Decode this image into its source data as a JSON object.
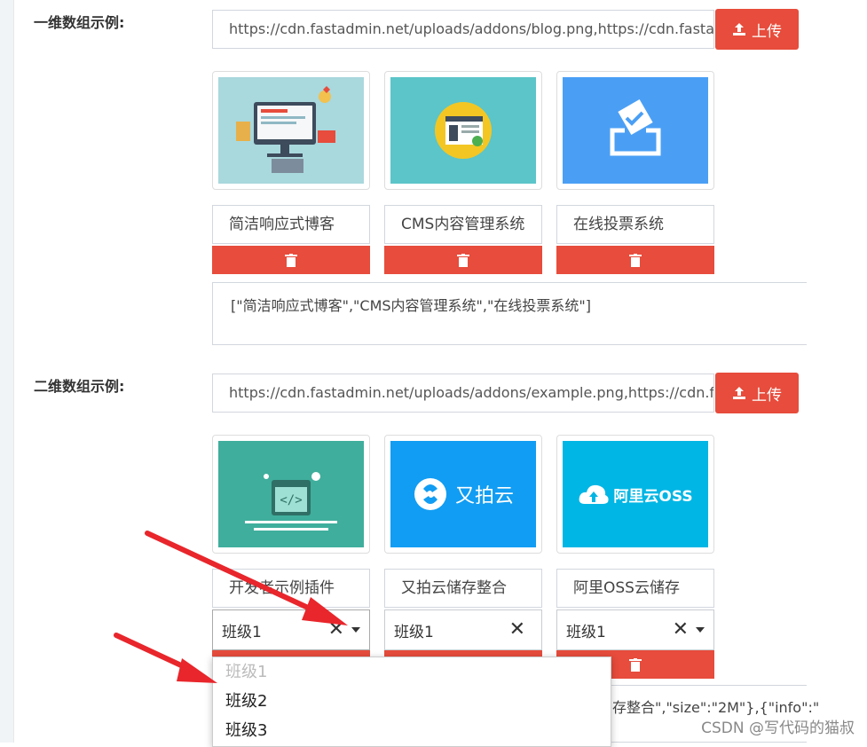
{
  "section1": {
    "label": "一维数组示例:",
    "url_value": "https://cdn.fastadmin.net/uploads/addons/blog.png,https://cdn.fastac",
    "upload_label": "上传",
    "items": [
      {
        "name": "简洁响应式博客",
        "thumb": "blog-illustration"
      },
      {
        "name": "CMS内容管理系统",
        "thumb": "cms-illustration"
      },
      {
        "name": "在线投票系统",
        "thumb": "vote-illustration"
      }
    ],
    "json_text": "[\"简洁响应式博客\",\"CMS内容管理系统\",\"在线投票系统\"]"
  },
  "section2": {
    "label": "二维数组示例:",
    "url_value": "https://cdn.fastadmin.net/uploads/addons/example.png,https://cdn.fa",
    "upload_label": "上传",
    "items": [
      {
        "name": "开发者示例插件",
        "class": "班级1",
        "thumb": "dev-illustration"
      },
      {
        "name": "又拍云储存整合",
        "class": "班级1",
        "thumb": "upyun-logo",
        "logo_text": "又拍云"
      },
      {
        "name": "阿里OSS云储存",
        "class": "班级1",
        "thumb": "oss-logo",
        "logo_text": "阿里云OSS"
      }
    ],
    "json_partial": "存整合\",\"size\":\"2M\"},{\"info\":\"",
    "dropdown_options": [
      {
        "label": "班级1",
        "disabled": true
      },
      {
        "label": "班级2",
        "disabled": false
      },
      {
        "label": "班级3",
        "disabled": false
      }
    ]
  },
  "watermark": "CSDN @写代码的猫叔",
  "colors": {
    "accent": "#e74c3c",
    "arrow": "#e8262b"
  }
}
